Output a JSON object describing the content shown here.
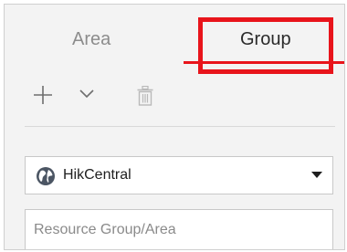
{
  "tabs": {
    "area_label": "Area",
    "group_label": "Group",
    "active": "Group"
  },
  "toolbar": {
    "add_icon": "plus-icon",
    "expand_icon": "chevron-down-icon",
    "delete_icon": "trash-icon"
  },
  "site_selector": {
    "icon": "globe-icon",
    "selected": "HikCentral",
    "dropdown_icon": "caret-down-icon"
  },
  "search": {
    "placeholder": "Resource Group/Area",
    "value": ""
  },
  "colors": {
    "accent": "#e8141b",
    "panel_background": "#f3f3f3",
    "globe": "#4b5563"
  }
}
